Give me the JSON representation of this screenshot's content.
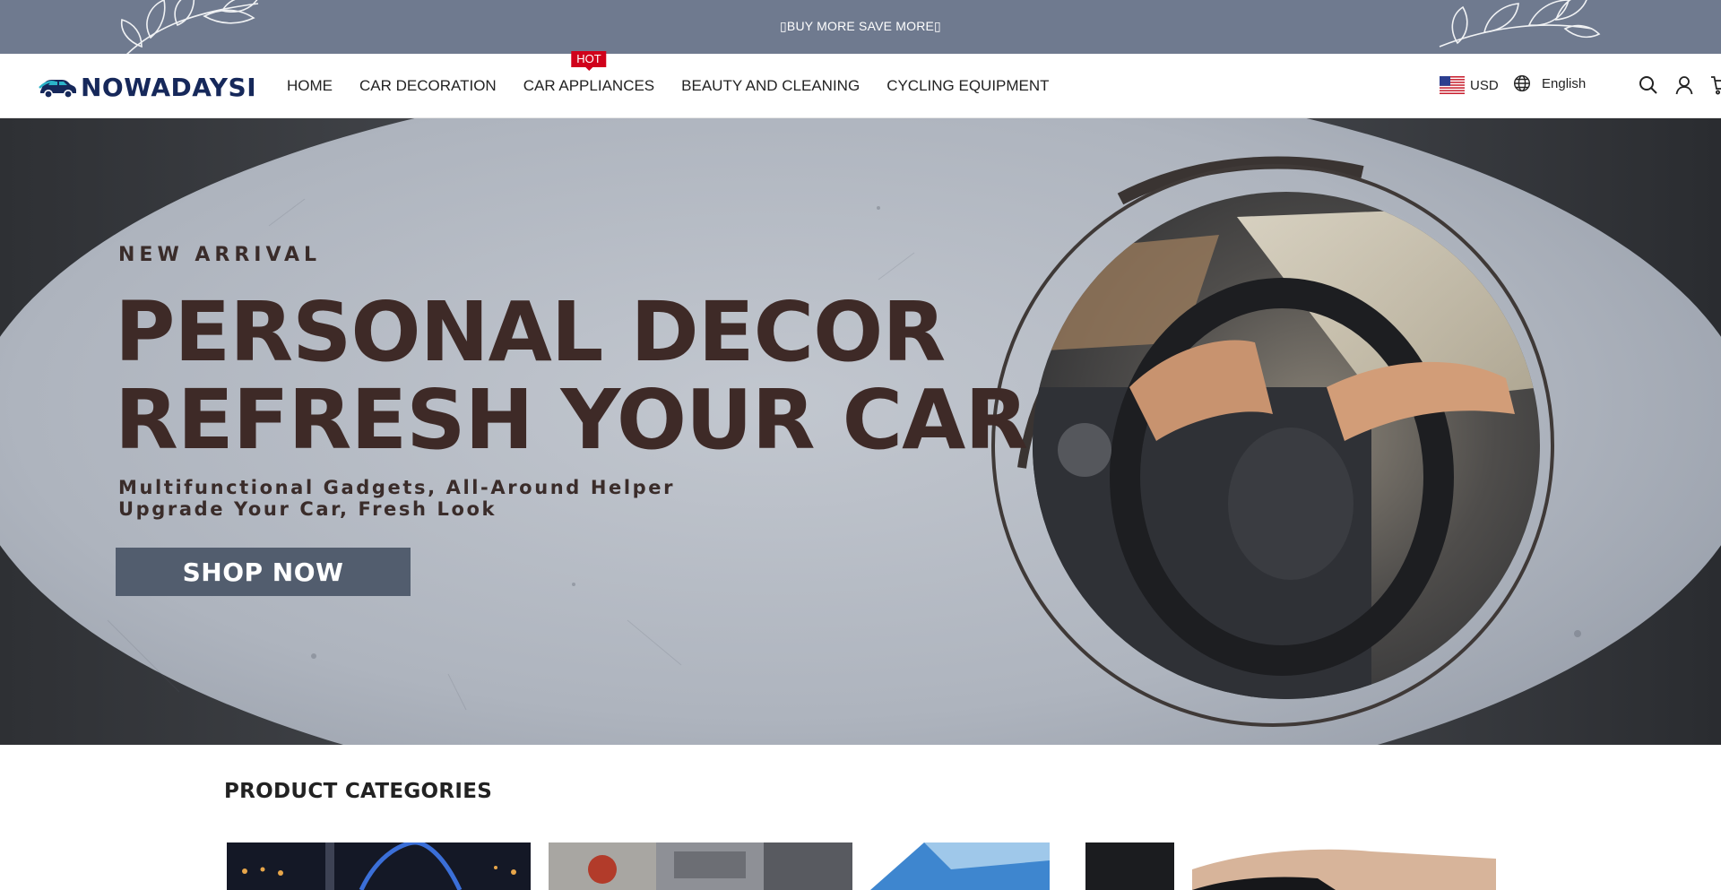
{
  "announcement": {
    "text": "▯BUY MORE SAVE MORE▯"
  },
  "header": {
    "logo_text": "NOWADAYSI",
    "nav": [
      {
        "label": "HOME"
      },
      {
        "label": "CAR DECORATION"
      },
      {
        "label": "CAR APPLIANCES",
        "badge": "HOT"
      },
      {
        "label": "BEAUTY AND CLEANING"
      },
      {
        "label": "CYCLING EQUIPMENT"
      }
    ],
    "currency": "USD",
    "language": "English",
    "icons": [
      "us-flag-icon",
      "globe-icon",
      "search-icon",
      "account-icon",
      "cart-icon"
    ]
  },
  "hero": {
    "eyebrow": "NEW ARRIVAL",
    "headline_line1": "PERSONAL DECOR",
    "headline_line2": "REFRESH YOUR CAR",
    "sub_line1": "Multifunctional Gadgets, All-Around Helper",
    "sub_line2": "Upgrade Your Car, Fresh Look",
    "cta": "SHOP NOW"
  },
  "categories": {
    "title": "PRODUCT CATEGORIES",
    "items": [
      {
        "image": "city-night-bridge"
      },
      {
        "image": "engine-bay"
      },
      {
        "image": "car-window"
      },
      {
        "image": "hand-glove"
      }
    ]
  },
  "colors": {
    "announcement_bg": "#6f7a8f",
    "hot_badge": "#d0021b",
    "logo": "#16285a",
    "headline": "#3e2a27",
    "cta_bg": "#525d6e"
  }
}
